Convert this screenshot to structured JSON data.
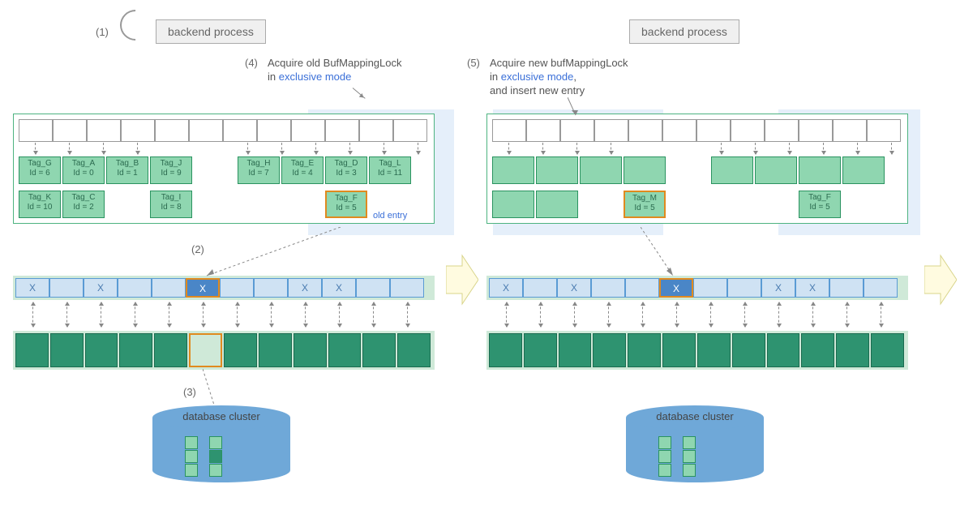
{
  "steps": {
    "s1": "(1)",
    "s2": "(2)",
    "s3": "(3)",
    "s4": "(4)",
    "s5": "(5)"
  },
  "backend_left": "backend process",
  "backend_right": "backend process",
  "caption4_line1": "Acquire old BufMappingLock",
  "caption4_line2_pre": "in ",
  "caption4_line2_em": "exclusive  mode",
  "caption5_line1": "Acquire new bufMappingLock",
  "caption5_line2_pre": "in ",
  "caption5_line2_em": "exclusive  mode",
  "caption5_line2_post": ",",
  "caption5_line3": "and insert new entry",
  "old_entry_label": "old entry",
  "db_label_left": "database cluster",
  "db_label_right": "database cluster",
  "chart_data": {
    "type": "diagram",
    "left_panel": {
      "hash_buckets": 12,
      "entries_row1": [
        {
          "tag": "Tag_G",
          "id": 6
        },
        {
          "tag": "Tag_A",
          "id": 0
        },
        {
          "tag": "Tag_B",
          "id": 1
        },
        {
          "tag": "Tag_J",
          "id": 9
        },
        null,
        {
          "tag": "Tag_H",
          "id": 7
        },
        {
          "tag": "Tag_E",
          "id": 4
        },
        {
          "tag": "Tag_D",
          "id": 3
        },
        {
          "tag": "Tag_L",
          "id": 11
        }
      ],
      "entries_row2": [
        {
          "tag": "Tag_K",
          "id": 10
        },
        {
          "tag": "Tag_C",
          "id": 2
        },
        null,
        {
          "tag": "Tag_I",
          "id": 8
        },
        null,
        null,
        null,
        {
          "tag": "Tag_F",
          "id": 5,
          "highlight": true,
          "note": "old entry"
        }
      ],
      "lock_region_buckets": [
        8,
        9,
        10,
        11
      ],
      "buffer_descriptors": [
        "X",
        "",
        "X",
        "",
        "",
        "X",
        "",
        "",
        "X",
        "X",
        "",
        ""
      ],
      "selected_buffer_index": 5,
      "highlighted_block_index": 5
    },
    "right_panel": {
      "hash_buckets": 12,
      "lock_region_new_buckets": [
        0,
        1,
        2,
        3
      ],
      "lock_region_old_buckets": [
        8,
        9,
        10,
        11
      ],
      "new_entry": {
        "tag": "Tag_M",
        "id": 5,
        "highlight": true
      },
      "retained_old_entry": {
        "tag": "Tag_F",
        "id": 5
      },
      "buffer_descriptors": [
        "X",
        "",
        "X",
        "",
        "",
        "X",
        "",
        "",
        "X",
        "X",
        "",
        ""
      ],
      "selected_buffer_index": 5
    }
  },
  "entries_left_r1": {
    "e0": {
      "tag": "Tag_G",
      "id": "Id = 6"
    },
    "e1": {
      "tag": "Tag_A",
      "id": "Id = 0"
    },
    "e2": {
      "tag": "Tag_B",
      "id": "Id = 1"
    },
    "e3": {
      "tag": "Tag_J",
      "id": "Id = 9"
    },
    "e5": {
      "tag": "Tag_H",
      "id": "Id = 7"
    },
    "e6": {
      "tag": "Tag_E",
      "id": "Id = 4"
    },
    "e7": {
      "tag": "Tag_D",
      "id": "Id = 3"
    },
    "e8": {
      "tag": "Tag_L",
      "id": "Id = 11"
    }
  },
  "entries_left_r2": {
    "e0": {
      "tag": "Tag_K",
      "id": "Id = 10"
    },
    "e1": {
      "tag": "Tag_C",
      "id": "Id = 2"
    },
    "e3": {
      "tag": "Tag_I",
      "id": "Id = 8"
    },
    "e7": {
      "tag": "Tag_F",
      "id": "Id = 5"
    }
  },
  "entry_right_new": {
    "tag": "Tag_M",
    "id": "Id = 5"
  },
  "entry_right_old": {
    "tag": "Tag_F",
    "id": "Id = 5"
  },
  "buf_x": "X"
}
